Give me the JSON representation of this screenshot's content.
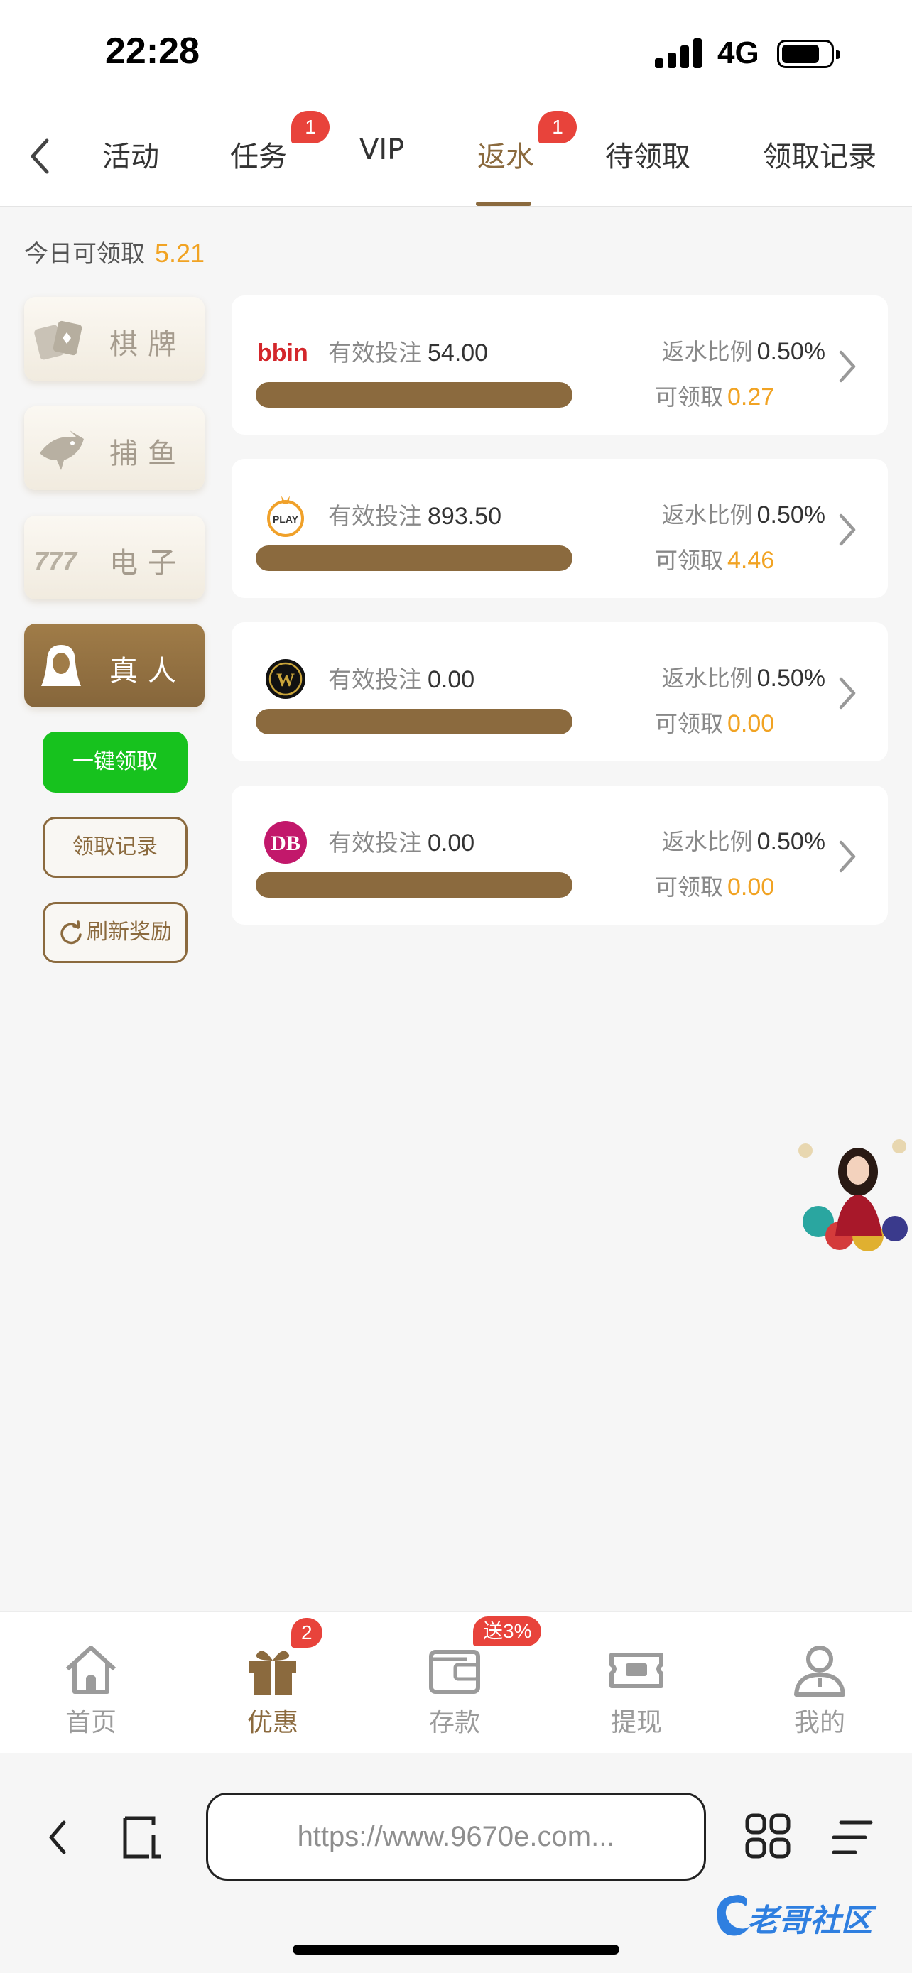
{
  "status_bar": {
    "time": "22:28",
    "network": "4G"
  },
  "tabs": [
    {
      "label": "活动",
      "active": false
    },
    {
      "label": "任务",
      "active": false,
      "badge": "1"
    },
    {
      "label": "VIP",
      "active": false
    },
    {
      "label": "返水",
      "active": true,
      "badge": "1"
    },
    {
      "label": "待领取",
      "active": false
    },
    {
      "label": "领取记录",
      "active": false
    }
  ],
  "summary": {
    "label": "今日可领取",
    "amount": "5.21"
  },
  "categories": [
    {
      "label": "棋牌",
      "icon": "cards-icon",
      "active": false
    },
    {
      "label": "捕鱼",
      "icon": "shark-icon",
      "active": false
    },
    {
      "label": "电子",
      "icon": "slot-777-icon",
      "active": false
    },
    {
      "label": "真人",
      "icon": "live-dealer-icon",
      "active": true
    }
  ],
  "actions": {
    "claim_all": "一键领取",
    "records": "领取记录",
    "refresh": "刷新奖励"
  },
  "card_labels": {
    "bet": "有效投注",
    "rate": "返水比例",
    "claimable": "可领取"
  },
  "cards": [
    {
      "provider_logo": "bbin",
      "bet": "54.00",
      "rate": "0.50%",
      "claimable": "0.27"
    },
    {
      "provider_logo": "PLAY",
      "bet": "893.50",
      "rate": "0.50%",
      "claimable": "4.46"
    },
    {
      "provider_logo": "W",
      "bet": "0.00",
      "rate": "0.50%",
      "claimable": "0.00"
    },
    {
      "provider_logo": "DB",
      "bet": "0.00",
      "rate": "0.50%",
      "claimable": "0.00"
    }
  ],
  "bottom_nav": [
    {
      "label": "首页",
      "icon": "home-icon",
      "active": false
    },
    {
      "label": "优惠",
      "icon": "gift-icon",
      "active": true,
      "badge": "2"
    },
    {
      "label": "存款",
      "icon": "wallet-icon",
      "active": false,
      "badge": "送3%"
    },
    {
      "label": "提现",
      "icon": "withdraw-icon",
      "active": false
    },
    {
      "label": "我的",
      "icon": "user-icon",
      "active": false
    }
  ],
  "browser": {
    "url": "https://www.9670e.com..."
  },
  "watermark": "老哥社区",
  "colors": {
    "accent": "#8b6a3e",
    "gold": "#f1a323",
    "green": "#17c21e",
    "badge": "#e8433b"
  }
}
